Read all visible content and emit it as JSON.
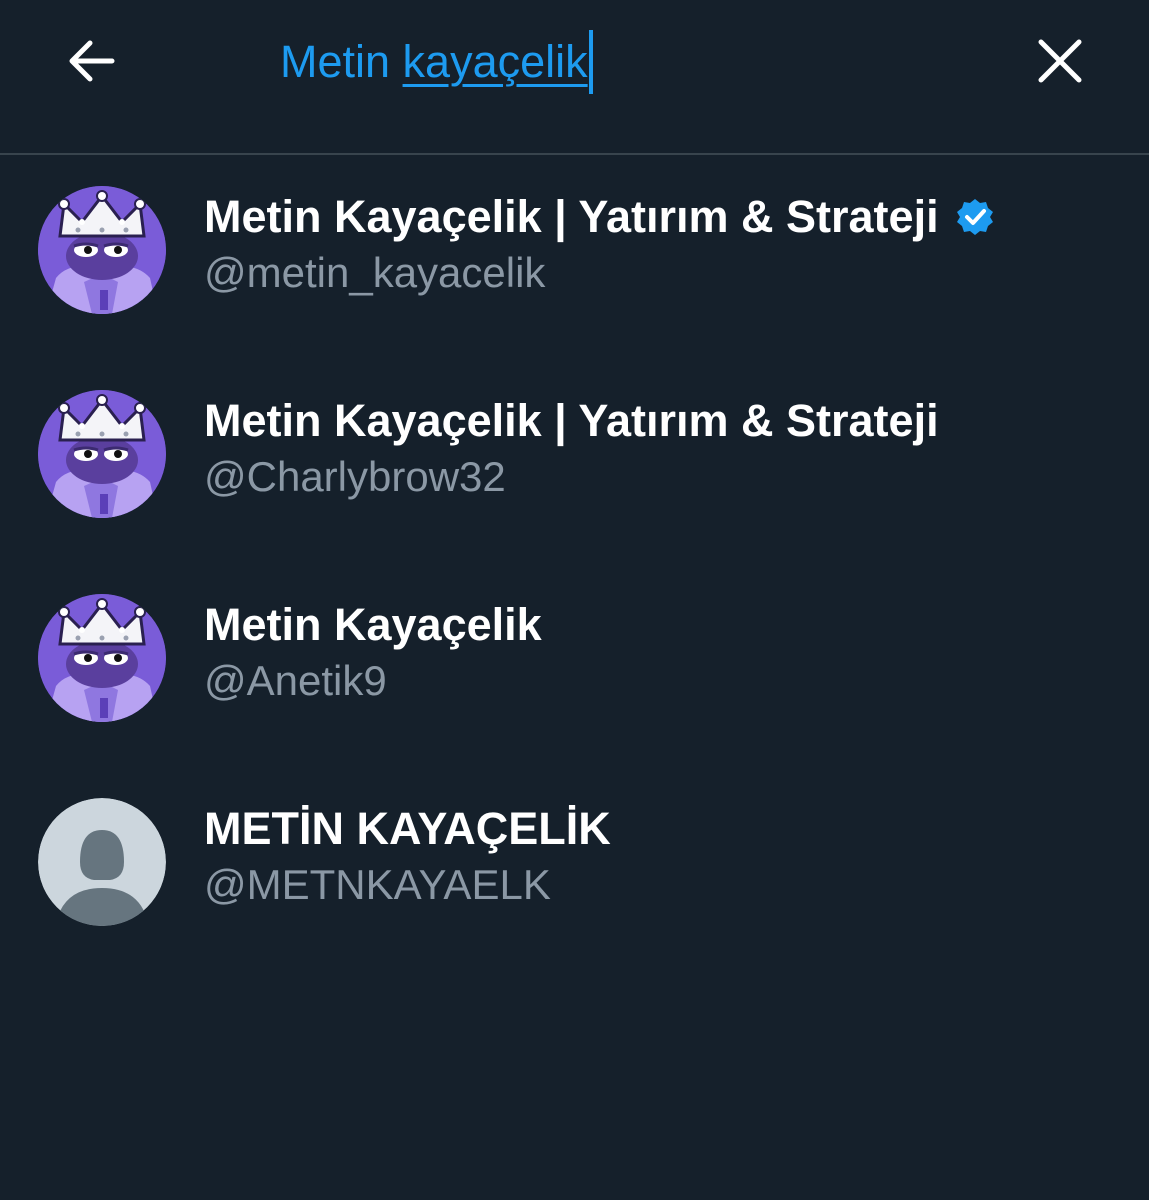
{
  "search": {
    "query_word1": "Metin ",
    "query_word2": "kayaçelik"
  },
  "header": {
    "back_icon": "arrow-left-icon",
    "clear_icon": "close-icon"
  },
  "results": [
    {
      "display_name": "Metin Kayaçelik | Yatırım & Strateji",
      "handle": "@metin_kayacelik",
      "verified": true,
      "avatar": "purple-frog-crown-avatar"
    },
    {
      "display_name": "Metin Kayaçelik | Yatırım & Strateji",
      "handle": "@Charlybrow32",
      "verified": false,
      "avatar": "purple-frog-crown-avatar"
    },
    {
      "display_name": "Metin Kayaçelik",
      "handle": "@Anetik9",
      "verified": false,
      "avatar": "purple-frog-crown-avatar"
    },
    {
      "display_name": "METİN KAYAÇELİK",
      "handle": "@METNKAYAELK",
      "verified": false,
      "avatar": "default-profile-avatar"
    }
  ],
  "colors": {
    "background": "#15202b",
    "accent": "#1d9bf0",
    "divider": "#38444d",
    "handle_text": "#8b98a5",
    "avatar_purple": "#7b5cd6"
  }
}
